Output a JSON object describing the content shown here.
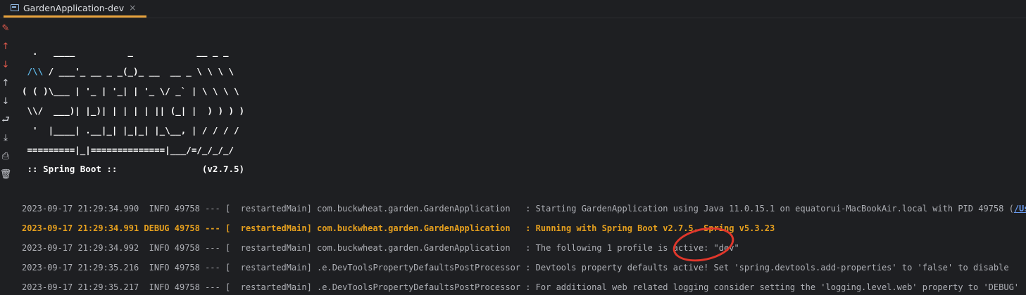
{
  "tab": {
    "title": "GardenApplication-dev",
    "close_glyph": "×"
  },
  "toolbar": [
    {
      "name": "clear-icon",
      "glyph": "✎",
      "color": "red"
    },
    {
      "name": "previous-error-icon",
      "glyph": "↑",
      "color": "red"
    },
    {
      "name": "next-error-icon",
      "glyph": "↓",
      "color": "red"
    },
    {
      "name": "scroll-up-icon",
      "glyph": "↑",
      "color": "normal"
    },
    {
      "name": "scroll-down-icon",
      "glyph": "↓",
      "color": "normal"
    },
    {
      "name": "soft-wrap-icon",
      "glyph": "⮐",
      "color": "normal"
    },
    {
      "name": "scroll-to-end-icon",
      "glyph": "⤓",
      "color": "normal"
    },
    {
      "name": "print-icon",
      "glyph": "⎙",
      "color": "normal"
    },
    {
      "name": "trash-icon",
      "glyph": "🗑",
      "color": "normal"
    }
  ],
  "banner": {
    "line1": "  .   ____          _            __ _ _",
    "line2_prefix": " ",
    "line2_cyan": "/\\\\",
    "line2_rest": " / ___'_ __ _ _(_)_ __  __ _ \\ \\ \\ \\",
    "line3": "( ( )\\___ | '_ | '_| | '_ \\/ _` | \\ \\ \\ \\",
    "line4": " \\\\/  ___)| |_)| | | | | || (_| |  ) ) ) )",
    "line5": "  '  |____| .__|_| |_|_| |_\\__, | / / / /",
    "line6": " =========|_|==============|___/=/_/_/_/",
    "line7": " :: Spring Boot ::                (v2.7.5)"
  },
  "logs": [
    {
      "level": "INFO",
      "text": "2023-09-17 21:29:34.990  INFO 49758 --- [  restartedMain] com.buckwheat.garden.GardenApplication   : Starting GardenApplication using Java 11.0.15.1 on equatorui-MacBookAir.local with PID 49758 (",
      "link": "/Users/eq"
    },
    {
      "level": "DEBUG",
      "text": "2023-09-17 21:29:34.991 DEBUG 49758 --- [  restartedMain] com.buckwheat.garden.GardenApplication   : Running with Spring Boot v2.7.5, Spring v5.3.23",
      "link": ""
    },
    {
      "level": "INFO",
      "text": "2023-09-17 21:29:34.992  INFO 49758 --- [  restartedMain] com.buckwheat.garden.GardenApplication   : The following 1 profile is active: \"dev\"",
      "link": ""
    },
    {
      "level": "INFO",
      "text": "2023-09-17 21:29:35.216  INFO 49758 --- [  restartedMain] .e.DevToolsPropertyDefaultsPostProcessor : Devtools property defaults active! Set 'spring.devtools.add-properties' to 'false' to disable",
      "link": ""
    },
    {
      "level": "INFO",
      "text": "2023-09-17 21:29:35.217  INFO 49758 --- [  restartedMain] .e.DevToolsPropertyDefaultsPostProcessor : For additional web related logging consider setting the 'logging.level.web' property to 'DEBUG'",
      "link": ""
    }
  ],
  "colors": {
    "accent_tab_underline": "#e8a33d",
    "debug_text": "#e6a01e",
    "annotation_circle": "#e0372b"
  }
}
